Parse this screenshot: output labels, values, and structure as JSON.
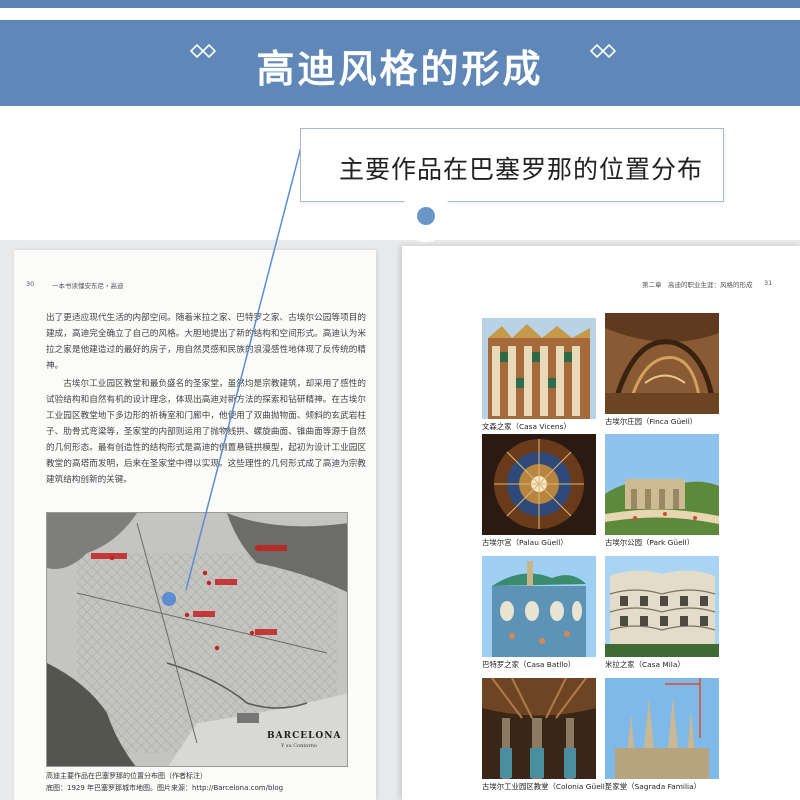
{
  "banner": {
    "title": "高迪风格的形成"
  },
  "callout": {
    "text": "主要作品在巴塞罗那的位置分布"
  },
  "left_page": {
    "page_number": "30",
    "running_head": "一本书读懂安东尼・高迪",
    "paragraphs": [
      "出了更适应现代生活的内部空间。随着米拉之家、巴特罗之家、古埃尔公园等项目的建成，高迪完全确立了自己的风格。大胆地提出了新的结构和空间形式。高迪认为米拉之家是他建造过的最好的房子，用自然灵感和民族的浪漫感性地体现了反传统的精神。",
      "古埃尔工业园区教堂和最负盛名的圣家堂，虽然均是宗教建筑，却采用了感性的试验结构和自然有机的设计理念，体现出高迪对新方法的探索和钻研精神。在古埃尔工业园区教堂地下多边形的祈祷室和门廊中，他使用了双曲抛物面、倾斜的玄武岩柱子、肋骨式弯梁等，圣家堂的内部则运用了抛物线拱、螺旋曲面、锥曲面等源于自然的几何形态。最有创造性的结构形式是高迪的倒置悬链拱模型，起初为设计工业园区教堂的高塔而发明，后来在圣家堂中得以实现。这些理性的几何形式成了高迪为宗教建筑结构创新的关键。"
    ],
    "map": {
      "label_city": "BARCELONA",
      "label_sub": "Y su Contorno"
    },
    "caption_line1": "高迪主要作品在巴塞罗那的位置分布图（作者标注）",
    "caption_line2": "底图：1929 年巴塞罗那城市地图。图片来源：http://Barcelona.com/blog"
  },
  "right_page": {
    "running_head": "第二章　高迪的职业生涯：风格的形成",
    "page_number": "31",
    "photos": [
      {
        "caption": "文森之家（Casa Vicens）"
      },
      {
        "caption": "古埃尔庄园（Finca Güell）"
      },
      {
        "caption": "古埃尔宫（Palau Güell）"
      },
      {
        "caption": "古埃尔公园（Park Güell）"
      },
      {
        "caption": "巴特罗之家（Casa Batllo）"
      },
      {
        "caption": "米拉之家（Casa Mila）"
      },
      {
        "caption": "古埃尔工业园区教堂（Colonia Güell）"
      },
      {
        "caption": "圣家堂（Sagrada Familia）"
      }
    ]
  },
  "colors": {
    "banner": "#5f87b7",
    "accent_dot": "#6b97c8",
    "marker": "#c42121"
  }
}
